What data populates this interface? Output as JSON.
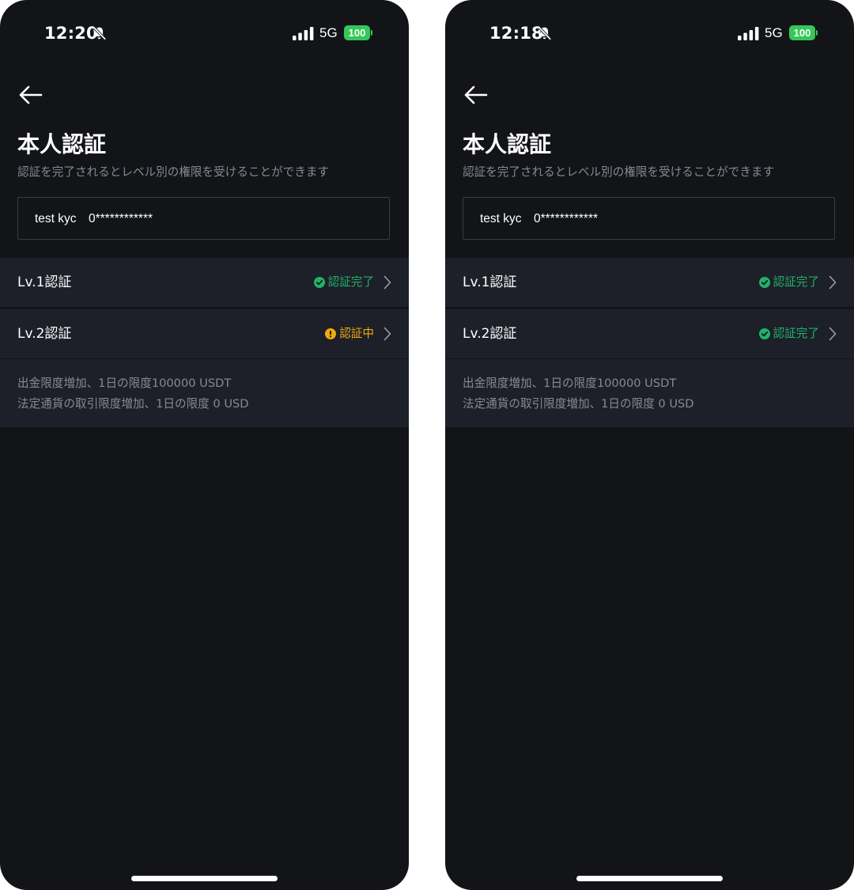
{
  "screens": [
    {
      "time": "12:20",
      "network": "5G",
      "battery": "100",
      "title": "本人認証",
      "subtitle": "認証を完了されるとレベル別の権限を受けることができます",
      "account_name": "test kyc",
      "account_id": "0************",
      "levels": [
        {
          "label": "Lv.1認証",
          "status": "認証完了",
          "state": "done"
        },
        {
          "label": "Lv.2認証",
          "status": "認証中",
          "state": "in-progress"
        }
      ],
      "info": [
        "出金限度増加、1日の限度100000 USDT",
        "法定通貨の取引限度増加、1日の限度 0 USD"
      ]
    },
    {
      "time": "12:18",
      "network": "5G",
      "battery": "100",
      "title": "本人認証",
      "subtitle": "認証を完了されるとレベル別の権限を受けることができます",
      "account_name": "test kyc",
      "account_id": "0************",
      "levels": [
        {
          "label": "Lv.1認証",
          "status": "認証完了",
          "state": "done"
        },
        {
          "label": "Lv.2認証",
          "status": "認証完了",
          "state": "done"
        }
      ],
      "info": [
        "出金限度増加、1日の限度100000 USDT",
        "法定通貨の取引限度増加、1日の限度 0 USD"
      ]
    }
  ],
  "colors": {
    "background": "#121418",
    "row_background": "#1d2028",
    "done": "#20b26c",
    "in_progress": "#f0a90c",
    "muted_text": "#868a93",
    "battery": "#34c759"
  },
  "icons": {
    "back": "arrow-left-icon",
    "silent": "bell-slash-icon",
    "signal": "signal-bars-icon",
    "done": "check-circle-icon",
    "in_progress": "exclamation-circle-icon",
    "chevron": "chevron-right-icon"
  }
}
